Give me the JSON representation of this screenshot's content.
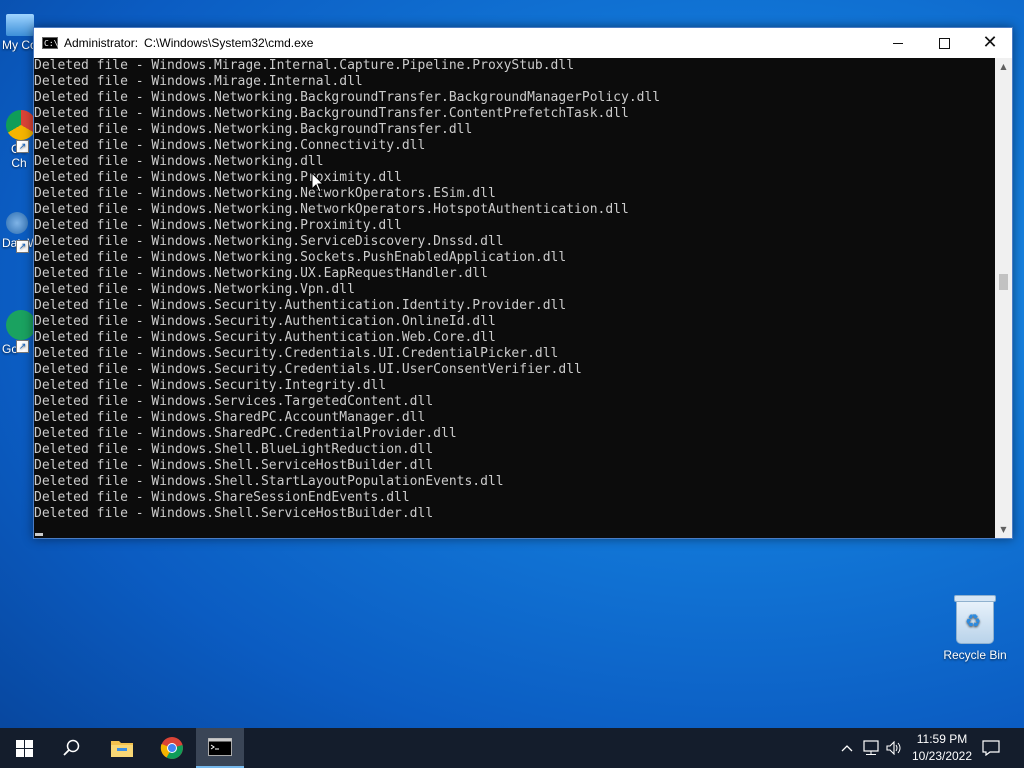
{
  "desktop": {
    "left_icons": [
      {
        "label": "My Co"
      },
      {
        "label": "Go\nCh"
      },
      {
        "label": "DataW"
      },
      {
        "label": "Go"
      }
    ],
    "recycle_bin": {
      "label": "Recycle Bin"
    }
  },
  "window": {
    "title_prefix": "Administrator:",
    "title_path": "C:\\Windows\\System32\\cmd.exe",
    "icon_text": "C:\\"
  },
  "console": {
    "lines": [
      "Deleted file - Windows.Mirage.Internal.Capture.Pipeline.ProxyStub.dll",
      "Deleted file - Windows.Mirage.Internal.dll",
      "Deleted file - Windows.Networking.BackgroundTransfer.BackgroundManagerPolicy.dll",
      "Deleted file - Windows.Networking.BackgroundTransfer.ContentPrefetchTask.dll",
      "Deleted file - Windows.Networking.BackgroundTransfer.dll",
      "Deleted file - Windows.Networking.Connectivity.dll",
      "Deleted file - Windows.Networking.dll",
      "Deleted file - Windows.Networking.Proximity.dll",
      "Deleted file - Windows.Networking.NetworkOperators.ESim.dll",
      "Deleted file - Windows.Networking.NetworkOperators.HotspotAuthentication.dll",
      "Deleted file - Windows.Networking.Proximity.dll",
      "Deleted file - Windows.Networking.ServiceDiscovery.Dnssd.dll",
      "Deleted file - Windows.Networking.Sockets.PushEnabledApplication.dll",
      "Deleted file - Windows.Networking.UX.EapRequestHandler.dll",
      "Deleted file - Windows.Networking.Vpn.dll",
      "Deleted file - Windows.Security.Authentication.Identity.Provider.dll",
      "Deleted file - Windows.Security.Authentication.OnlineId.dll",
      "Deleted file - Windows.Security.Authentication.Web.Core.dll",
      "Deleted file - Windows.Security.Credentials.UI.CredentialPicker.dll",
      "Deleted file - Windows.Security.Credentials.UI.UserConsentVerifier.dll",
      "Deleted file - Windows.Security.Integrity.dll",
      "Deleted file - Windows.Services.TargetedContent.dll",
      "Deleted file - Windows.SharedPC.AccountManager.dll",
      "Deleted file - Windows.SharedPC.CredentialProvider.dll",
      "Deleted file - Windows.Shell.BlueLightReduction.dll",
      "Deleted file - Windows.Shell.ServiceHostBuilder.dll",
      "Deleted file - Windows.Shell.StartLayoutPopulationEvents.dll",
      "Deleted file - Windows.ShareSessionEndEvents.dll",
      "Deleted file - Windows.Shell.ServiceHostBuilder.dll"
    ]
  },
  "taskbar": {
    "items": [
      {
        "icon": "windows-start-icon"
      },
      {
        "icon": "search-icon"
      },
      {
        "icon": "file-explorer-icon"
      },
      {
        "icon": "chrome-icon"
      },
      {
        "icon": "cmd-icon",
        "active": true
      }
    ],
    "tray": {
      "time": "11:59 PM",
      "date": "10/23/2022"
    }
  },
  "colors": {
    "console_bg": "#0c0c0c",
    "console_text": "#cccccc",
    "taskbar_bg": "#141d2c",
    "accent": "#76b9ed"
  }
}
